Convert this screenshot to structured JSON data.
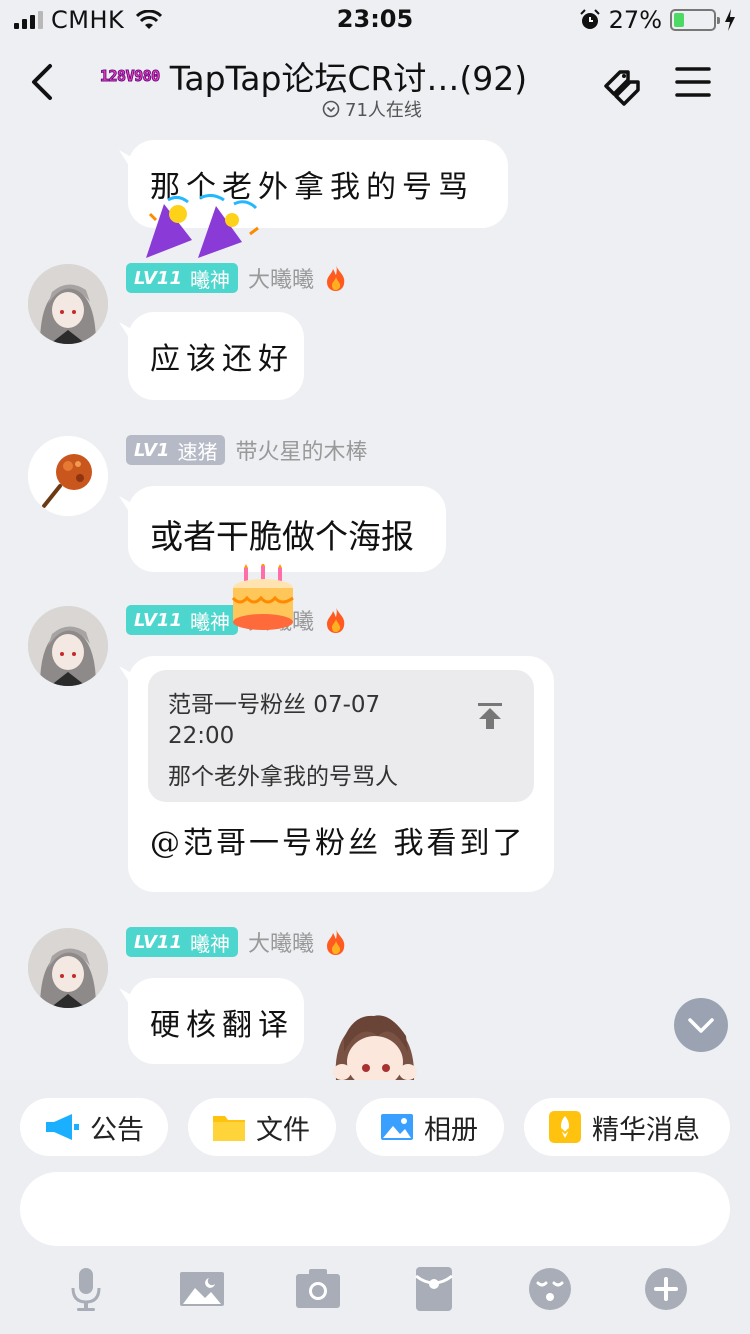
{
  "status_bar": {
    "carrier": "CMHK",
    "time": "23:05",
    "battery_percent": "27%",
    "battery_level": 0.27
  },
  "header": {
    "group_badge": "128V980",
    "title": "TapTap论坛CR讨…(92)",
    "online": "71人在线"
  },
  "messages": [
    {
      "text": "那个老外拿我的号骂人"
    },
    {
      "level": "LV11",
      "title": "曦神",
      "nickname": "大曦曦",
      "text": "应该还好"
    },
    {
      "level": "LV1",
      "title": "速猪",
      "nickname": "带火星的木棒",
      "text": "或者干脆做个海报"
    },
    {
      "level": "LV11",
      "title": "曦神",
      "nickname": "大曦曦",
      "quote": {
        "header": "范哥一号粉丝 07-07",
        "time": "22:00",
        "text": "那个老外拿我的号骂人"
      },
      "text": "@范哥一号粉丝 我看到了"
    },
    {
      "level": "LV11",
      "title": "曦神",
      "nickname": "大曦曦",
      "text": "硬核翻译"
    }
  ],
  "shortcuts": [
    {
      "label": "公告",
      "icon": "megaphone-icon"
    },
    {
      "label": "文件",
      "icon": "folder-icon"
    },
    {
      "label": "相册",
      "icon": "photo-album-icon"
    },
    {
      "label": "精华消息",
      "icon": "essence-icon"
    }
  ],
  "input": {
    "value": "",
    "placeholder": ""
  },
  "toolbar": [
    "microphone-icon",
    "image-icon",
    "camera-icon",
    "red-packet-icon",
    "emoji-icon",
    "plus-icon"
  ],
  "colors": {
    "background": "#edeff3",
    "level_teal": "#4dd6cd",
    "level_gray": "#b6bac6",
    "accent_blue": "#1ab0ff"
  }
}
